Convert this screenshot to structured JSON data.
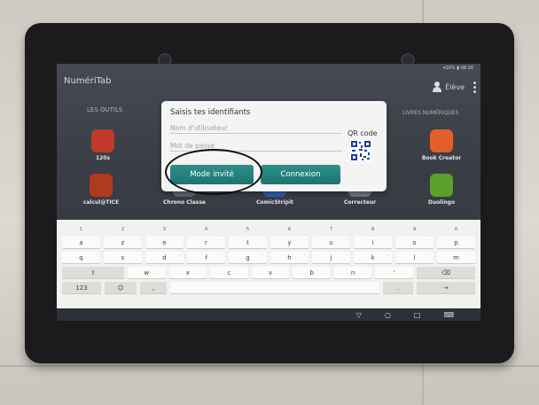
{
  "launcher": {
    "app_title": "NumériTab",
    "section_left": "LES OUTILS",
    "section_right": "LIVRES NUMÉRIQUES",
    "user_label": "Élève",
    "status": "▾16% ▮ 08:26",
    "apps": [
      {
        "name": "120s",
        "color": "#c0392b"
      },
      {
        "name": "calcul@TICE",
        "color": "#b03a1f"
      },
      {
        "name": "Chrono Classe",
        "color": "#5b6770"
      },
      {
        "name": "ComicStripit",
        "color": "#2e5ea8"
      },
      {
        "name": "Correcteur",
        "color": "#6f7680"
      },
      {
        "name": "Book Creator",
        "color": "#e35f2a"
      },
      {
        "name": "Duolingo",
        "color": "#5aa02c"
      }
    ]
  },
  "login_dialog": {
    "title": "Saisis tes identifiants",
    "username_placeholder": "Nom d'utilisateur",
    "password_placeholder": "Mot de passe",
    "qr_label": "QR code",
    "guest_button": "Mode invité",
    "login_button": "Connexion"
  },
  "keyboard": {
    "number_row": [
      "1",
      "2",
      "3",
      "4",
      "5",
      "6",
      "7",
      "8",
      "9",
      "0"
    ],
    "row1": [
      "a",
      "z",
      "e",
      "r",
      "t",
      "y",
      "u",
      "i",
      "o",
      "p"
    ],
    "row2": [
      "q",
      "s",
      "d",
      "f",
      "g",
      "h",
      "j",
      "k",
      "l",
      "m"
    ],
    "row3": [
      "w",
      "x",
      "c",
      "v",
      "b",
      "n",
      "'"
    ],
    "shift": "⇧",
    "backspace": "⌫",
    "sym": "123",
    "emoji": "☺",
    "comma": ",",
    "period": ".",
    "enter": "→"
  },
  "navbar": {
    "back": "▽",
    "home": "○",
    "recents": "□",
    "keyboard_hide": "⌨"
  },
  "colors": {
    "accent": "#1f7470",
    "dialog_bg": "#f4f4f4",
    "screen_bg": "#3a3d45"
  }
}
